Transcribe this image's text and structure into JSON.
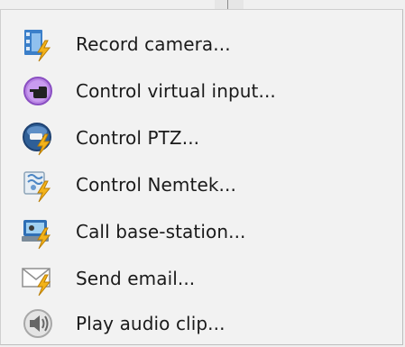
{
  "menu": {
    "items": [
      {
        "label": "Record camera...",
        "icon": "film-camera-lightning-icon"
      },
      {
        "label": "Control virtual input...",
        "icon": "hand-pointer-icon"
      },
      {
        "label": "Control PTZ...",
        "icon": "ptz-camera-lightning-icon"
      },
      {
        "label": "Control Nemtek...",
        "icon": "nemtek-fence-lightning-icon"
      },
      {
        "label": "Call base-station...",
        "icon": "base-station-lightning-icon"
      },
      {
        "label": "Send email...",
        "icon": "envelope-lightning-icon"
      },
      {
        "label": "Play audio clip...",
        "icon": "speaker-icon"
      }
    ]
  }
}
